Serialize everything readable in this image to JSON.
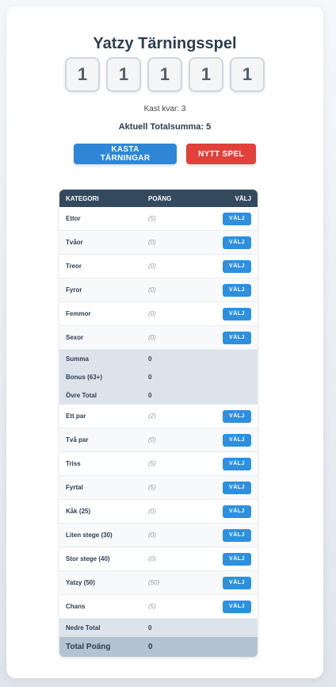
{
  "title": "Yatzy Tärningsspel",
  "dice": [
    "1",
    "1",
    "1",
    "1",
    "1"
  ],
  "rolls_left": "Kast kvar: 3",
  "total_sum": "Aktuell Totalsumma: 5",
  "buttons": {
    "roll": "KASTA TÄRNINGAR",
    "new_game": "NYTT SPEL"
  },
  "table": {
    "headers": {
      "category": "KATEGORI",
      "points": "POÄNG",
      "choose": "VÄLJ"
    },
    "pick_label": "VÄLJ",
    "upper": [
      {
        "name": "Ettor",
        "score": "(5)"
      },
      {
        "name": "Tvåor",
        "score": "(0)"
      },
      {
        "name": "Treor",
        "score": "(0)"
      },
      {
        "name": "Fyror",
        "score": "(0)"
      },
      {
        "name": "Femmor",
        "score": "(0)"
      },
      {
        "name": "Sexor",
        "score": "(0)"
      }
    ],
    "upper_summary": [
      {
        "name": "Summa",
        "value": "0"
      },
      {
        "name": "Bonus (63+)",
        "value": "0"
      },
      {
        "name": "Övre Total",
        "value": "0"
      }
    ],
    "lower": [
      {
        "name": "Ett par",
        "score": "(2)"
      },
      {
        "name": "Två par",
        "score": "(0)"
      },
      {
        "name": "Triss",
        "score": "(5)"
      },
      {
        "name": "Fyrtal",
        "score": "(5)"
      },
      {
        "name": "Kåk (25)",
        "score": "(0)"
      },
      {
        "name": "Liten stege (30)",
        "score": "(0)"
      },
      {
        "name": "Stor stege (40)",
        "score": "(0)"
      },
      {
        "name": "Yatzy (50)",
        "score": "(50)"
      },
      {
        "name": "Chans",
        "score": "(5)"
      }
    ],
    "lower_total": {
      "name": "Nedre Total",
      "value": "0"
    },
    "grand_total": {
      "name": "Total Poäng",
      "value": "0"
    }
  }
}
